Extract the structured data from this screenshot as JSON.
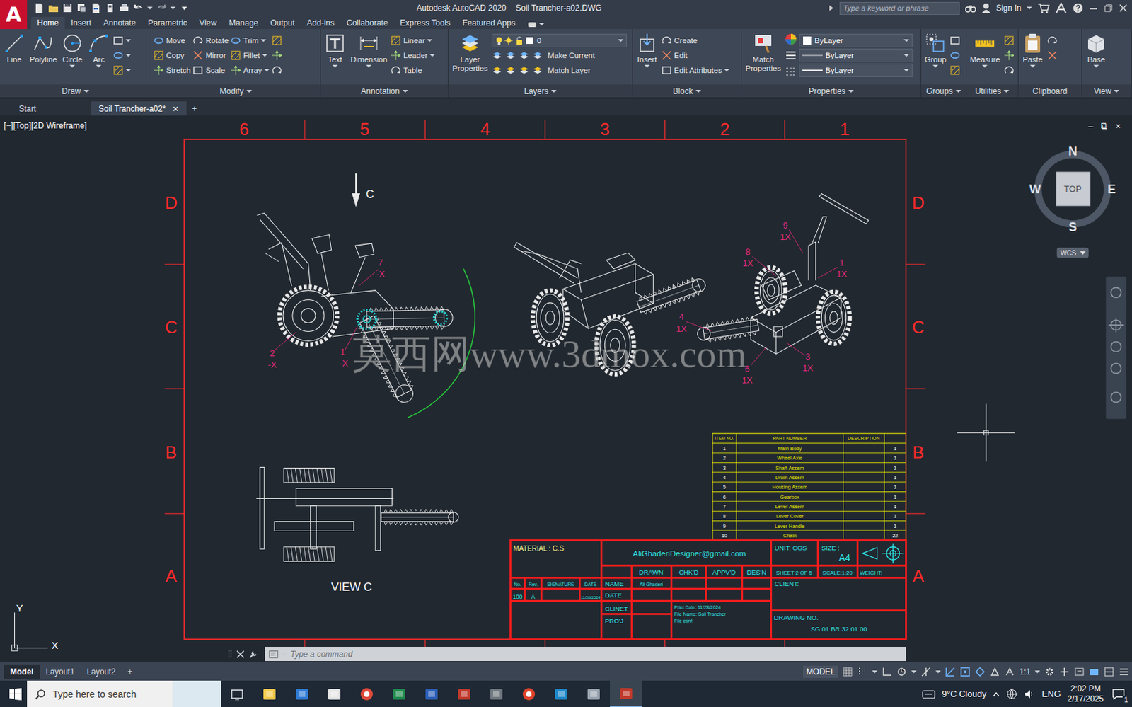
{
  "window": {
    "app": "Autodesk AutoCAD 2020",
    "file": "Soil Trancher-a02.DWG"
  },
  "app_logo": "A",
  "search": {
    "placeholder": "Type a keyword or phrase"
  },
  "account": {
    "sign_in": "Sign In"
  },
  "ribbon_tabs": [
    {
      "label": "Home",
      "selected": true
    },
    {
      "label": "Insert",
      "selected": false
    },
    {
      "label": "Annotate",
      "selected": false
    },
    {
      "label": "Parametric",
      "selected": false
    },
    {
      "label": "View",
      "selected": false
    },
    {
      "label": "Manage",
      "selected": false
    },
    {
      "label": "Output",
      "selected": false
    },
    {
      "label": "Add-ins",
      "selected": false
    },
    {
      "label": "Collaborate",
      "selected": false
    },
    {
      "label": "Express Tools",
      "selected": false
    },
    {
      "label": "Featured Apps",
      "selected": false
    }
  ],
  "panels": [
    {
      "kind": "standard",
      "title": "Draw",
      "has_menu": true,
      "large": [
        {
          "label": "Line",
          "has_menu": false
        },
        {
          "label": "Polyline",
          "has_menu": false
        },
        {
          "label": "Circle",
          "has_menu": true
        },
        {
          "label": "Arc",
          "has_menu": true
        }
      ],
      "columns": [],
      "icon_buttons": [
        {
          "has_menu": true
        },
        {
          "has_menu": true
        },
        {
          "has_menu": true
        }
      ]
    },
    {
      "kind": "standard",
      "title": "Modify",
      "has_menu": true,
      "large": [],
      "columns": [
        [
          {
            "label": "Move",
            "has_menu": false
          },
          {
            "label": "Copy",
            "has_menu": false
          },
          {
            "label": "Stretch",
            "has_menu": false
          }
        ],
        [
          {
            "label": "Rotate",
            "has_menu": false
          },
          {
            "label": "Mirror",
            "has_menu": false
          },
          {
            "label": "Scale",
            "has_menu": false
          }
        ],
        [
          {
            "label": "Trim",
            "has_menu": true
          },
          {
            "label": "Fillet",
            "has_menu": true
          },
          {
            "label": "Array",
            "has_menu": true
          }
        ]
      ],
      "icon_buttons": [
        {
          "has_menu": false
        },
        {
          "has_menu": false
        },
        {
          "has_menu": false
        }
      ]
    },
    {
      "kind": "standard",
      "title": "Annotation",
      "has_menu": true,
      "large": [
        {
          "label": "Text",
          "has_menu": true
        },
        {
          "label": "Dimension",
          "has_menu": true
        }
      ],
      "columns": [
        [
          {
            "label": "Linear",
            "has_menu": true
          },
          {
            "label": "Leader",
            "has_menu": true
          },
          {
            "label": "Table",
            "has_menu": false
          }
        ]
      ],
      "icon_buttons": []
    },
    {
      "kind": "layers",
      "title": "Layers",
      "has_menu": true,
      "large": [
        {
          "label": "Layer Properties",
          "has_menu": false
        }
      ],
      "layer": "0",
      "actions": [
        {
          "label": "Make Current"
        },
        {
          "label": "Match Layer"
        }
      ]
    },
    {
      "kind": "standard",
      "title": "Block",
      "has_menu": true,
      "large": [
        {
          "label": "Insert",
          "has_menu": true
        }
      ],
      "columns": [
        [
          {
            "label": "Create",
            "has_menu": false
          },
          {
            "label": "Edit",
            "has_menu": false
          },
          {
            "label": "Edit Attributes",
            "has_menu": true
          }
        ]
      ],
      "icon_buttons": []
    },
    {
      "kind": "properties",
      "title": "Properties",
      "has_menu": true,
      "large": [
        {
          "label": "Match Properties",
          "has_menu": false
        }
      ],
      "dropdowns": [
        "ByLayer",
        "ByLayer",
        "ByLayer"
      ]
    },
    {
      "kind": "standard",
      "title": "Groups",
      "has_menu": true,
      "large": [
        {
          "label": "Group",
          "has_menu": true
        }
      ],
      "columns": [],
      "icon_buttons": [
        {
          "has_menu": false
        },
        {
          "has_menu": false
        },
        {
          "has_menu": false
        }
      ]
    },
    {
      "kind": "standard",
      "title": "Utilities",
      "has_menu": true,
      "large": [
        {
          "label": "Measure",
          "has_menu": true
        }
      ],
      "columns": [],
      "icon_buttons": [
        {
          "has_menu": false
        },
        {
          "has_menu": false
        },
        {
          "has_menu": false
        }
      ]
    },
    {
      "kind": "standard",
      "title": "Clipboard",
      "has_menu": false,
      "large": [
        {
          "label": "Paste",
          "has_menu": true
        }
      ],
      "columns": [],
      "icon_buttons": [
        {
          "has_menu": false
        },
        {
          "has_menu": false
        }
      ]
    },
    {
      "kind": "standard",
      "title": "View",
      "has_menu": true,
      "large": [
        {
          "label": "Base",
          "has_menu": true
        }
      ],
      "columns": [],
      "icon_buttons": []
    }
  ],
  "file_tabs": [
    {
      "label": "Start",
      "selected": false,
      "closable": false
    },
    {
      "label": "Soil Trancher-a02*",
      "selected": true,
      "closable": true
    }
  ],
  "file_tab_close": "×",
  "new_tab": "+",
  "viewport": {
    "label": "[−][Top][2D Wireframe]",
    "controls": [
      "–",
      "⧉",
      "×"
    ]
  },
  "viewcube": {
    "north": "N",
    "south": "S",
    "east": "E",
    "west": "W",
    "face": "TOP",
    "ucs": "WCS"
  },
  "axes": {
    "x": "X",
    "y": "Y"
  },
  "sheet": {
    "columns": [
      "6",
      "5",
      "4",
      "3",
      "2",
      "1"
    ],
    "rows": [
      "D",
      "C",
      "B",
      "A"
    ],
    "view_arrow": "C",
    "view_label": "VIEW C",
    "watermark": "莫西网www.3dmox.com",
    "balloons": [
      {
        "number": "7",
        "qty": "-X"
      },
      {
        "number": "2",
        "qty": "-X"
      },
      {
        "number": "1",
        "qty": "-X"
      },
      {
        "number": "9",
        "qty": "1X"
      },
      {
        "number": "8",
        "qty": "1X"
      },
      {
        "number": "1",
        "qty": "1X"
      },
      {
        "number": "4",
        "qty": "1X"
      },
      {
        "number": "3",
        "qty": "1X"
      },
      {
        "number": "6",
        "qty": "1X"
      }
    ]
  },
  "bom": {
    "columns": [
      "ITEM NO.",
      "PART NUMBER",
      "DESCRIPTION",
      ""
    ],
    "rows": [
      [
        "1",
        "Main Body",
        "",
        "1"
      ],
      [
        "2",
        "Wheel Axle",
        "",
        "1"
      ],
      [
        "3",
        "Shaft Assem",
        "",
        "1"
      ],
      [
        "4",
        "Drum Assem",
        "",
        "1"
      ],
      [
        "5",
        "Housing Assem",
        "",
        "1"
      ],
      [
        "6",
        "Gearbox",
        "",
        "1"
      ],
      [
        "7",
        "Lever Assem",
        "",
        "1"
      ],
      [
        "8",
        "Lever Cover",
        "",
        "1"
      ],
      [
        "9",
        "Lever Handle",
        "",
        "1"
      ],
      [
        "10",
        "Chain",
        "",
        "22"
      ]
    ]
  },
  "title_block": {
    "material": "MATERIAL : C.S",
    "email": "AliGhaderiDesigner@gmail.com",
    "unit": "UNIT: CGS",
    "size_label": "SIZE :",
    "size": "A4",
    "roles": [
      "DRAWN",
      "CHK'D",
      "APPV'D",
      "DES'N"
    ],
    "sheet": "SHEET 2 OF 5",
    "scale": "SCALE:1:20",
    "weight": "WEIGHT:",
    "rev_headers": [
      "No.",
      "Rev.",
      "SIGNATURE",
      "DATE"
    ],
    "rev_row": [
      "100",
      "A",
      "",
      "11/28/2024"
    ],
    "row_labels": [
      "NAME",
      "DATE",
      "CLINET",
      "PRO'J"
    ],
    "drawn_by": "Ali Ghaderi",
    "client": "CLIENT:",
    "print_info": [
      "Print Date: 11/28/2024",
      "File Name:  Soil Trancher",
      "File conf:"
    ],
    "drawing_no_label": "DRAWING NO.",
    "drawing_no": "SG.01.BR.32.01.00"
  },
  "command_line": {
    "placeholder": "Type a command"
  },
  "layout_tabs": [
    {
      "label": "Model",
      "selected": true
    },
    {
      "label": "Layout1",
      "selected": false
    },
    {
      "label": "Layout2",
      "selected": false
    }
  ],
  "layout_add": "+",
  "status_bar": {
    "space": "MODEL",
    "scale": "1:1"
  },
  "taskbar": {
    "search_placeholder": "Type here to search",
    "apps": [
      {
        "selected": false
      },
      {
        "selected": false
      },
      {
        "selected": false
      },
      {
        "selected": false
      },
      {
        "selected": false
      },
      {
        "selected": false
      },
      {
        "selected": false
      },
      {
        "selected": false
      },
      {
        "selected": false
      },
      {
        "selected": false
      },
      {
        "selected": false
      },
      {
        "selected": false
      },
      {
        "selected": true
      }
    ],
    "weather": "9°C  Cloudy",
    "language": "ENG",
    "time": "2:02 PM",
    "date": "2/17/2025",
    "notification_count": "1"
  }
}
